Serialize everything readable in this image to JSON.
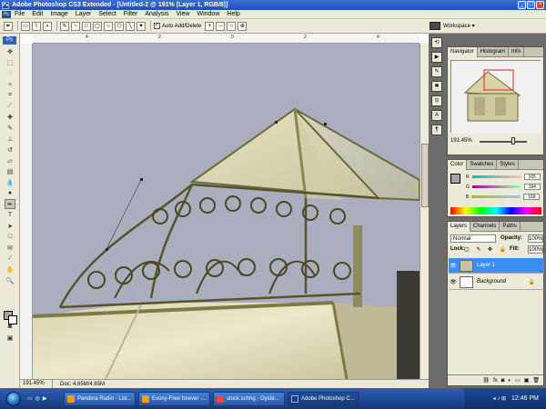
{
  "titlebar": {
    "title": "Adobe Photoshop CS3 Extended - [Untitled-2 @ 191% (Layer 1, RGB/8)]"
  },
  "menu": [
    "File",
    "Edit",
    "Image",
    "Layer",
    "Select",
    "Filter",
    "Analysis",
    "View",
    "Window",
    "Help"
  ],
  "options": {
    "auto_add_delete": "Auto Add/Delete",
    "workspace": "Workspace ▾"
  },
  "toolbox": {
    "label": "Ps"
  },
  "document": {
    "zoom": "191.45%",
    "doc_size": "Doc: 4.65M/4.65M",
    "ruler_ticks": [
      "4",
      "2",
      "0",
      "2",
      "4",
      "6"
    ]
  },
  "navigator": {
    "tabs": [
      "Navigator",
      "Histogram",
      "Info"
    ],
    "zoom": "191.45%"
  },
  "color_panel": {
    "tabs": [
      "Color",
      "Swatches",
      "Styles"
    ],
    "channels": [
      {
        "name": "R",
        "value": "165",
        "color": "#d23a3a"
      },
      {
        "name": "G",
        "value": "194",
        "color": "#3aa53a"
      },
      {
        "name": "B",
        "value": "169",
        "color": "#3a4fd2"
      }
    ],
    "foreground": "#a5a5a5"
  },
  "layers_panel": {
    "tabs": [
      "Layers",
      "Channels",
      "Paths"
    ],
    "blend_mode": "Normal",
    "opacity_label": "Opacity:",
    "opacity_value": "100%",
    "lock_label": "Lock:",
    "fill_label": "Fill:",
    "fill_value": "100%",
    "layers": [
      {
        "name": "Layer 1",
        "active": true
      },
      {
        "name": "Background",
        "active": false
      }
    ]
  },
  "taskbar": {
    "tasks": [
      {
        "label": "Pandora Radio - List...",
        "color": "#f39c12"
      },
      {
        "label": "Evony-Free forever -...",
        "color": "#f39c12"
      },
      {
        "label": "stock.schng - Oyste...",
        "color": "#e74c3c"
      },
      {
        "label": "Adobe Photoshop C...",
        "color": "#1c3f82"
      }
    ],
    "time": "12:46 PM"
  }
}
